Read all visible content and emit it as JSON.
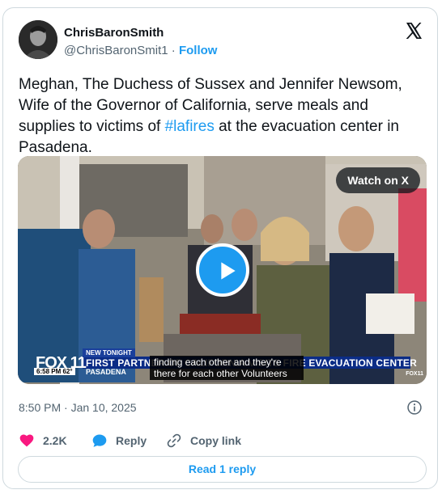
{
  "author": {
    "display_name": "ChrisBaronSmith",
    "handle": "@ChrisBaronSmit1",
    "separator": " · ",
    "follow_label": "Follow"
  },
  "tweet": {
    "text_before": "Meghan, The Duchess of Sussex and Jennifer Newsom, Wife of the Governor of California, serve meals and supplies to victims of ",
    "hashtag": "#lafires",
    "text_after": " at the evacuation center in Pasadena."
  },
  "media": {
    "watch_label": "Watch on X",
    "broadcast": {
      "logo": "FOX 11",
      "tag": "NEW TONIGHT",
      "headline": "FIRST PARTNER OF CALIFORNIA VISITS FIRE EVACUATION CENTER",
      "location": "PASADENA",
      "time": "6:58 PM  62°",
      "corner_logo": "FOX11"
    },
    "caption": "finding each other and they're there for each other Volunteers"
  },
  "timestamp": "8:50 PM · Jan 10, 2025",
  "actions": {
    "likes_count": "2.2K",
    "reply_label": "Reply",
    "copy_link_label": "Copy link"
  },
  "read_reply_label": "Read 1 reply",
  "colors": {
    "accent": "#1d9bf0",
    "like": "#f91880",
    "muted": "#536471",
    "border": "#cfd9de"
  },
  "icons": [
    "x-logo-icon",
    "play-icon",
    "info-icon",
    "heart-icon",
    "reply-bubble-icon",
    "link-icon"
  ]
}
